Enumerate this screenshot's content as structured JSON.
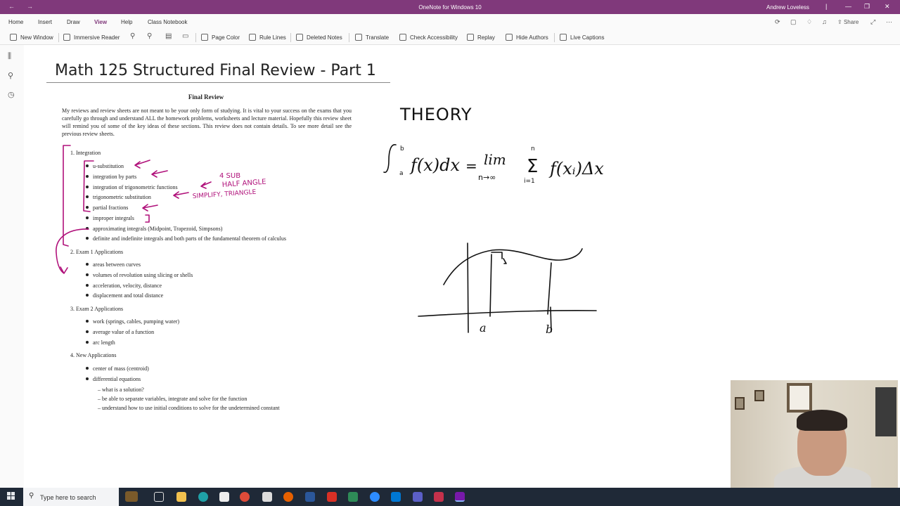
{
  "window": {
    "title": "OneNote for Windows 10",
    "user": "Andrew Loveless"
  },
  "menu": {
    "items": [
      "Home",
      "Insert",
      "Draw",
      "View",
      "Help",
      "Class Notebook"
    ],
    "active": "View",
    "share_label": "Share"
  },
  "ribbon": {
    "new_window": "New Window",
    "immersive_reader": "Immersive Reader",
    "page_color": "Page Color",
    "rule_lines": "Rule Lines",
    "deleted_notes": "Deleted Notes",
    "translate": "Translate",
    "check_accessibility": "Check Accessibility",
    "replay": "Replay",
    "hide_authors": "Hide Authors",
    "live_captions": "Live Captions"
  },
  "page": {
    "title": "Math 125 Structured Final Review - Part 1"
  },
  "review": {
    "heading": "Final Review",
    "intro": "My reviews and review sheets are not meant to be your only form of studying. It is vital to your success on the exams that you carefully go through and understand ALL the homework problems, worksheets and lecture material. Hopefully this review sheet will remind you of some of the key ideas of these sections. This review does not contain details. To see more detail see the previous review sheets.",
    "sections": [
      {
        "title": "1. Integration",
        "items": [
          "u-substitution",
          "integration by parts",
          "integration of trigonometric functions",
          "trigonometric substitution",
          "partial fractions",
          "improper integrals",
          "approximating integrals (Midpoint, Trapezoid, Simpsons)",
          "definite and indefinite integrals and both parts of the fundamental theorem of calculus"
        ]
      },
      {
        "title": "2. Exam 1 Applications",
        "items": [
          "areas between curves",
          "volumes of revolution using slicing or shells",
          "acceleration, velocity, distance",
          "displacement and total distance"
        ]
      },
      {
        "title": "3. Exam 2 Applications",
        "items": [
          "work (springs, cables, pumping water)",
          "average value of a function",
          "arc length"
        ]
      },
      {
        "title": "4. New Applications",
        "items": [
          "center of mass (centroid)",
          "differential equations"
        ],
        "subitems": [
          "– what is a solution?",
          "– be able to separate variables, integrate and solve for the function",
          "– understand how to use initial conditions to solve for the undetermined constant"
        ]
      }
    ]
  },
  "ink": {
    "theory": "THEORY",
    "annotation_1": "4 SUB",
    "annotation_2": "HALF ANGLE",
    "annotation_3": "SIMPLIFY, TRIANGLE",
    "label_a": "a",
    "label_b": "b"
  },
  "taskbar": {
    "search_placeholder": "Type here to search"
  }
}
